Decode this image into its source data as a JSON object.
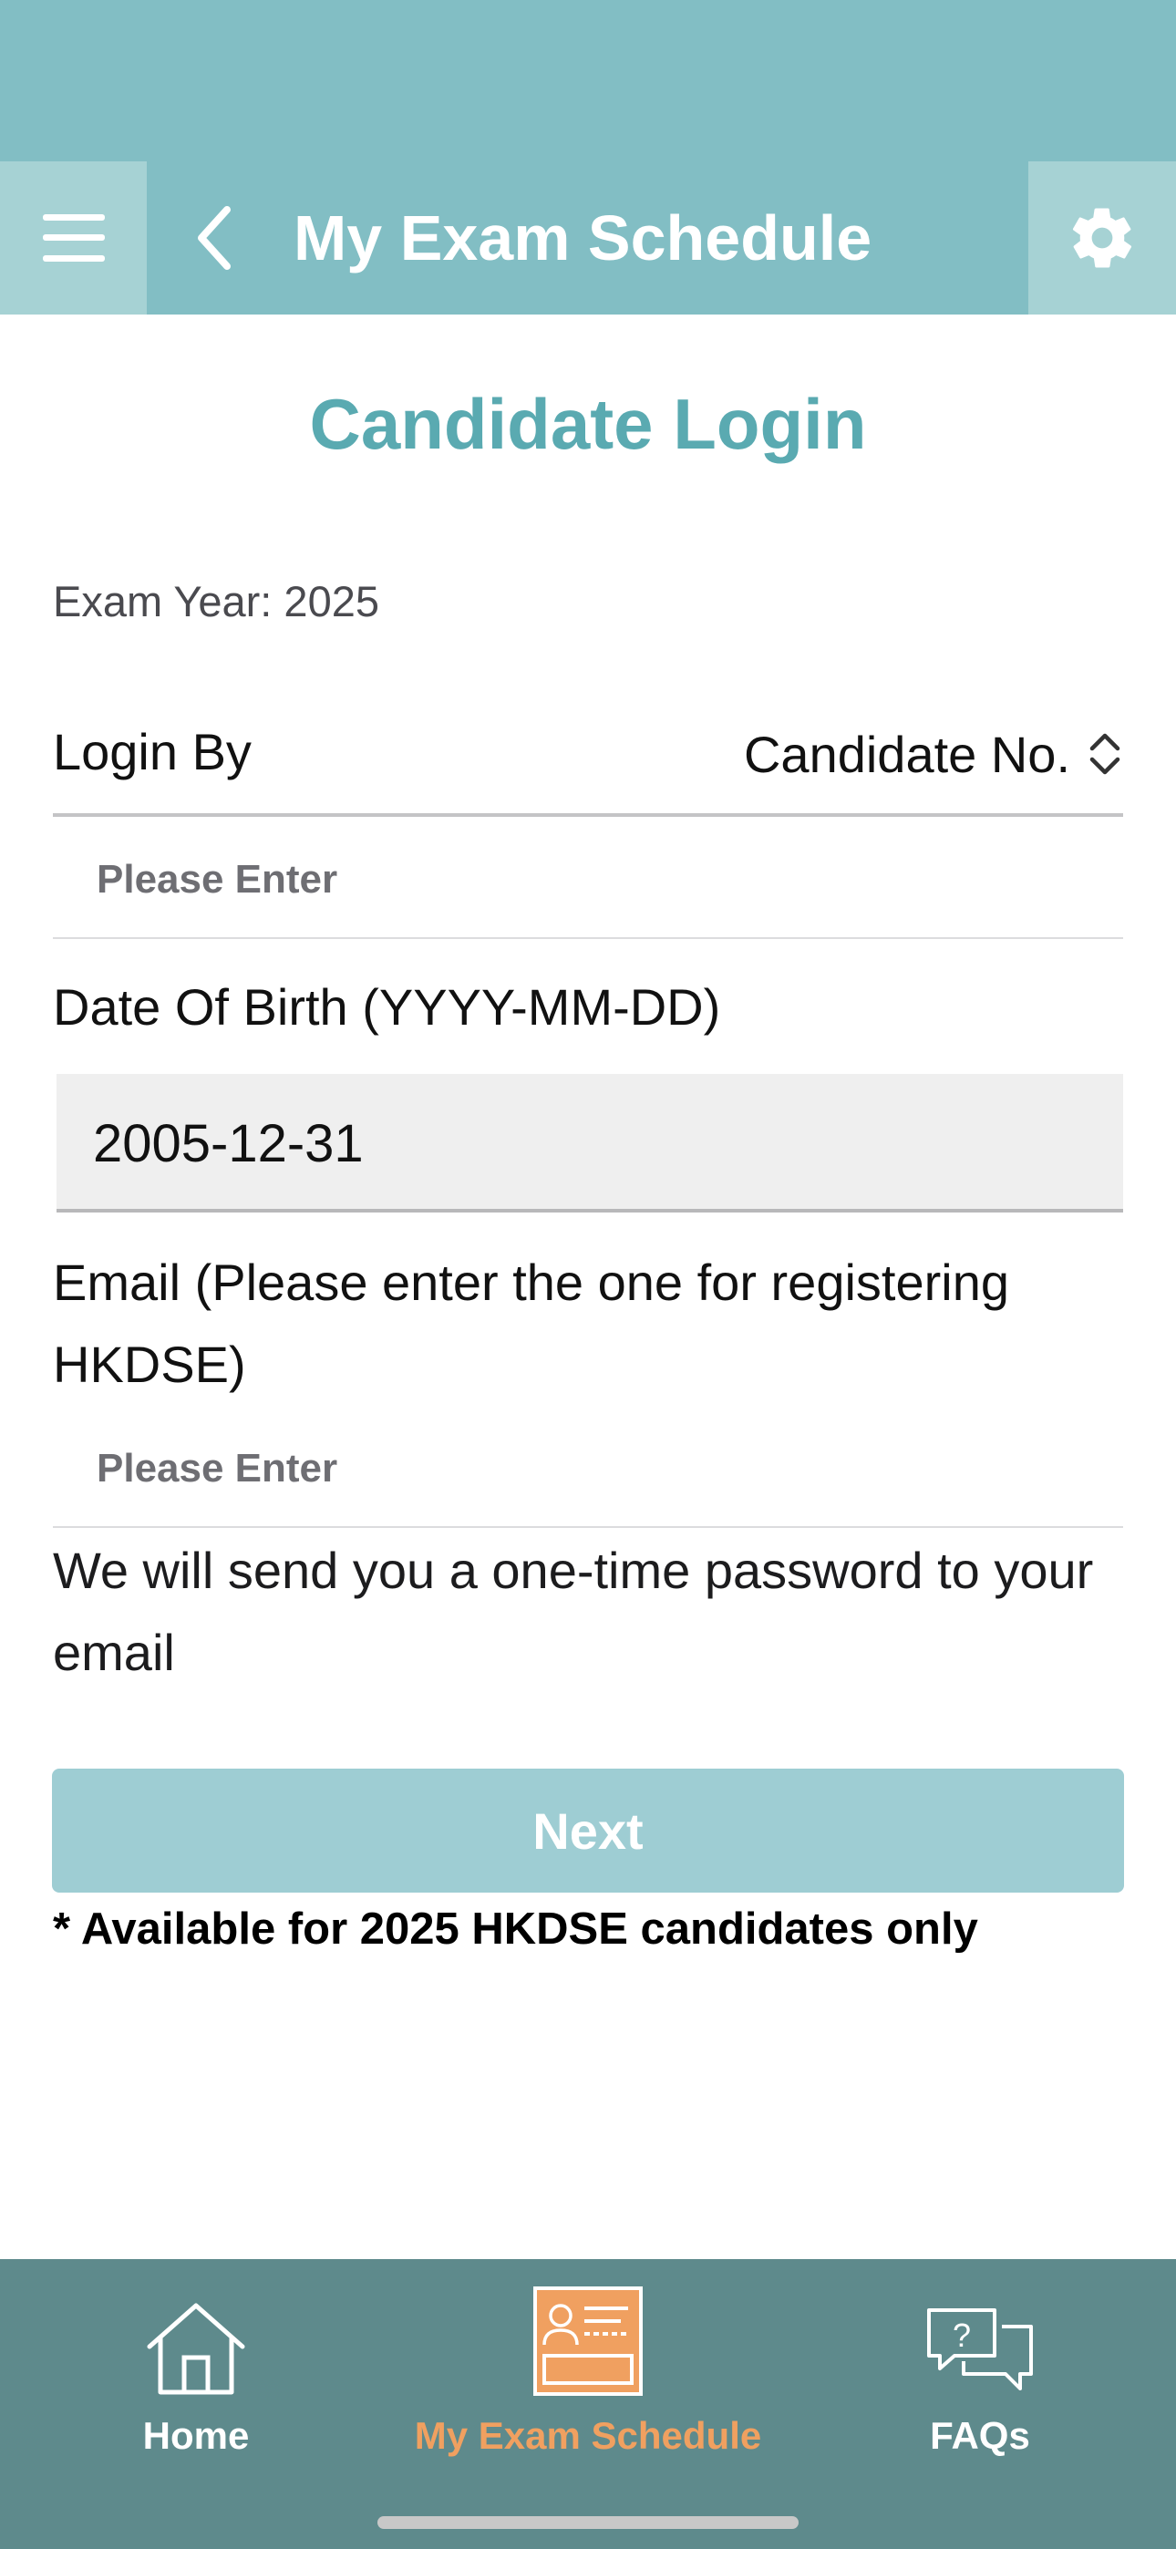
{
  "nav": {
    "title": "My Exam Schedule",
    "menu_icon": "hamburger-menu-icon",
    "back_icon": "chevron-left-icon",
    "settings_icon": "gear-icon"
  },
  "page": {
    "heading": "Candidate Login",
    "exam_year": "Exam Year: 2025"
  },
  "login_by": {
    "label": "Login By",
    "value": "Candidate No.",
    "icon": "chevron-up-down-icon"
  },
  "candidate_no": {
    "placeholder": "Please Enter",
    "value": ""
  },
  "dob": {
    "label": "Date Of Birth (YYYY-MM-DD)",
    "value": "2005-12-31"
  },
  "email": {
    "label": "Email (Please enter the one for registering HKDSE)",
    "placeholder": "Please Enter",
    "value": ""
  },
  "otp_note": "We will send you a one-time password to your email",
  "next_button": "Next",
  "availability_note": "* Available for 2025 HKDSE candidates only",
  "tabs": [
    {
      "label": "Home",
      "icon": "house-icon",
      "active": false
    },
    {
      "label": "My Exam Schedule",
      "icon": "exam-schedule-icon",
      "active": true
    },
    {
      "label": "FAQs",
      "icon": "chat-question-icon",
      "active": false
    }
  ],
  "colors": {
    "header": "#82bec4",
    "header_button": "#a6d2d4",
    "heading": "#5aaab1",
    "next_button": "#9ecdd3",
    "tab_bar": "#5e8a8c",
    "tab_active": "#f0a060"
  }
}
